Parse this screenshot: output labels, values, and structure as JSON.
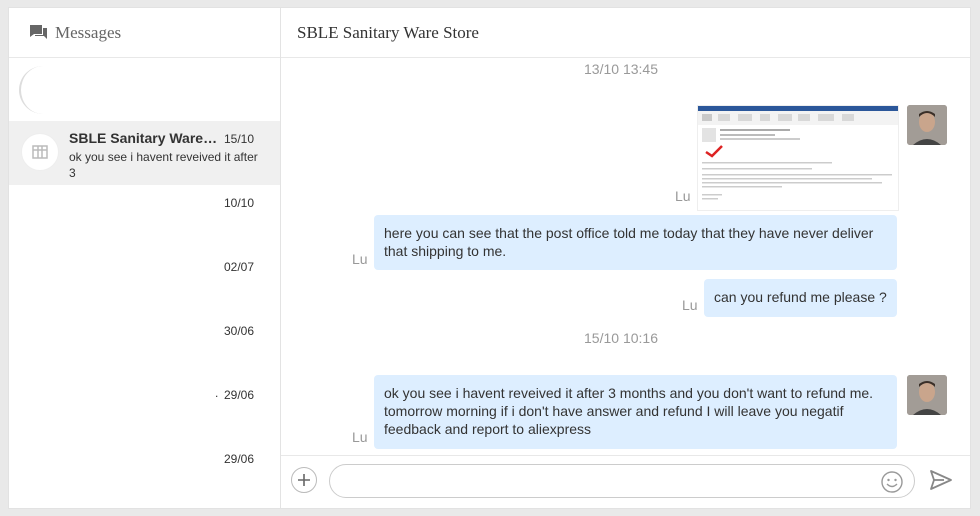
{
  "sidebar": {
    "title": "Messages",
    "conversations": [
      {
        "name": "SBLE Sanitary Ware Store",
        "date": "15/10",
        "preview": "ok you see i havent reveived it after 3",
        "active": true
      },
      {
        "name": "",
        "date": "10/10",
        "preview": ""
      },
      {
        "name": "",
        "date": "02/07",
        "preview": ""
      },
      {
        "name": "",
        "date": "30/06",
        "preview": ""
      },
      {
        "name": "",
        "date": "29/06",
        "preview": "",
        "dot": "."
      },
      {
        "name": "",
        "date": "29/06",
        "preview": ""
      }
    ]
  },
  "chat": {
    "title": "SBLE Sanitary Ware Store",
    "timestamps": [
      "13/10 13:45",
      "15/10 10:16"
    ],
    "messages": [
      {
        "sender": "Lu",
        "type": "image",
        "icon": "email-screenshot-image"
      },
      {
        "sender": "Lu",
        "text": "here you can see that the post office told me today that they have never deliver that shipping to me."
      },
      {
        "sender": "Lu",
        "text": "can you refund me please ?"
      },
      {
        "sender": "Lu",
        "text": "ok you see i havent reveived it after 3 months and you don't want to refund me. tomorrow morning if i don't have answer and refund I will leave you negatif feedback and report to aliexpress"
      }
    ]
  },
  "composer": {
    "placeholder": ""
  },
  "colors": {
    "bubble": "#ddeeff",
    "active_row": "#f0f0f0",
    "muted_text": "#999999"
  }
}
